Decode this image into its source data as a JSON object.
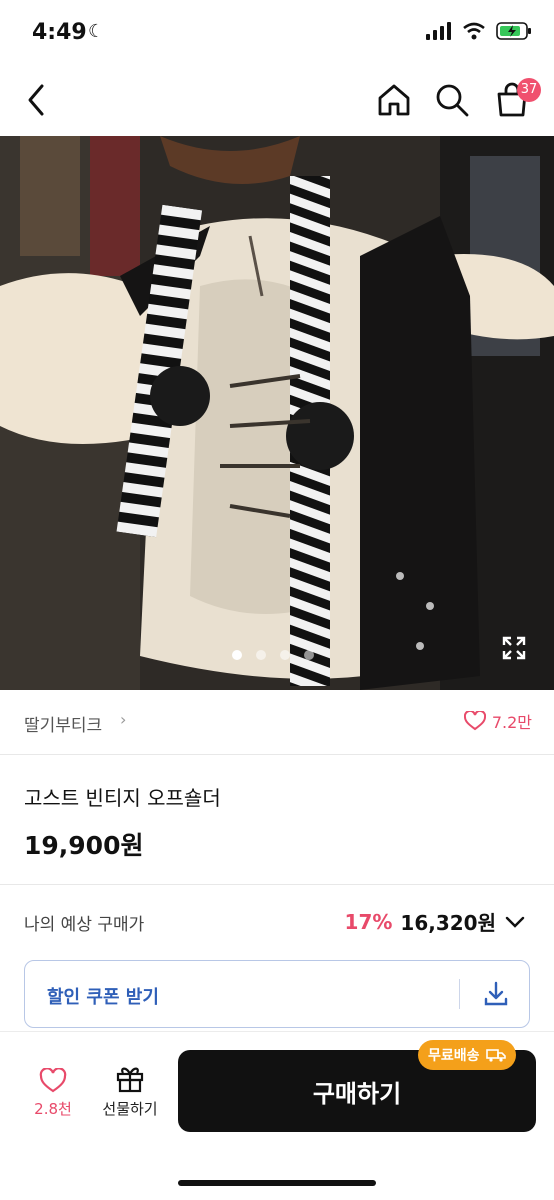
{
  "status": {
    "time": "4:49"
  },
  "nav": {
    "cart_count": "37"
  },
  "hero": {
    "image_count": 4,
    "active_index": 0
  },
  "seller": {
    "name": "딸기부티크",
    "like_count": "7.2만"
  },
  "product": {
    "title": "고스트 빈티지 오프숄더",
    "price": "19,900원"
  },
  "expected": {
    "label": "나의 예상 구매가",
    "discount": "17%",
    "price": "16,320원"
  },
  "coupon": {
    "label": "할인 쿠폰 받기"
  },
  "bottom": {
    "like_count": "2.8천",
    "gift_label": "선물하기",
    "buy_label": "구매하기",
    "free_ship_label": "무료배송"
  },
  "colors": {
    "accent_pink": "#e84a6a",
    "coupon_blue": "#2f5fb8",
    "free_ship_orange": "#f4a01a",
    "badge_pink": "#f0506e"
  }
}
